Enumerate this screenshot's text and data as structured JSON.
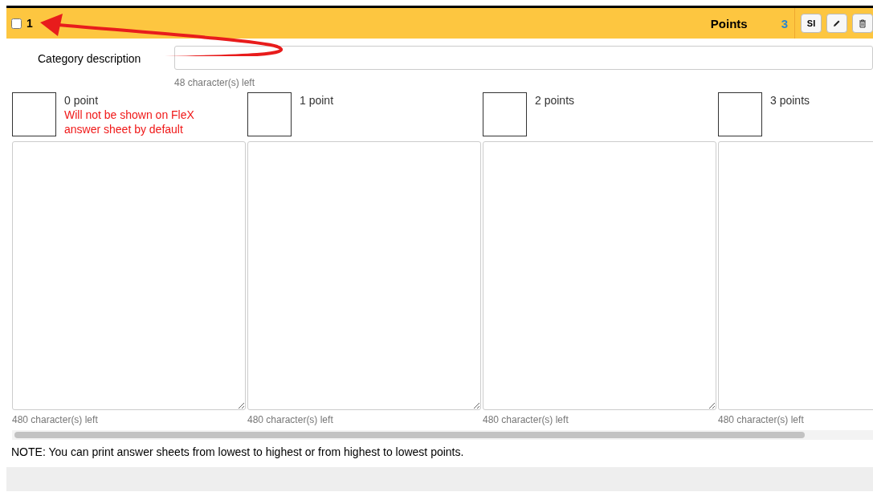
{
  "header": {
    "checked": false,
    "number": "1",
    "points_label": "Points",
    "points_value": "3",
    "buttons": [
      {
        "kind": "text",
        "label": "SI"
      },
      {
        "kind": "edit"
      },
      {
        "kind": "delete"
      }
    ]
  },
  "category": {
    "label": "Category description",
    "counter": "48 character(s) left"
  },
  "levels": [
    {
      "title": "0 point",
      "note": "Will not be shown on FleX answer sheet by default",
      "counter": "480 character(s) left"
    },
    {
      "title": "1 point",
      "counter": "480 character(s) left"
    },
    {
      "title": "2 points",
      "counter": "480 character(s) left"
    },
    {
      "title": "3 points",
      "counter": "480 character(s) left"
    }
  ],
  "note": "NOTE: You can print answer sheets from lowest to highest or from highest to lowest points."
}
